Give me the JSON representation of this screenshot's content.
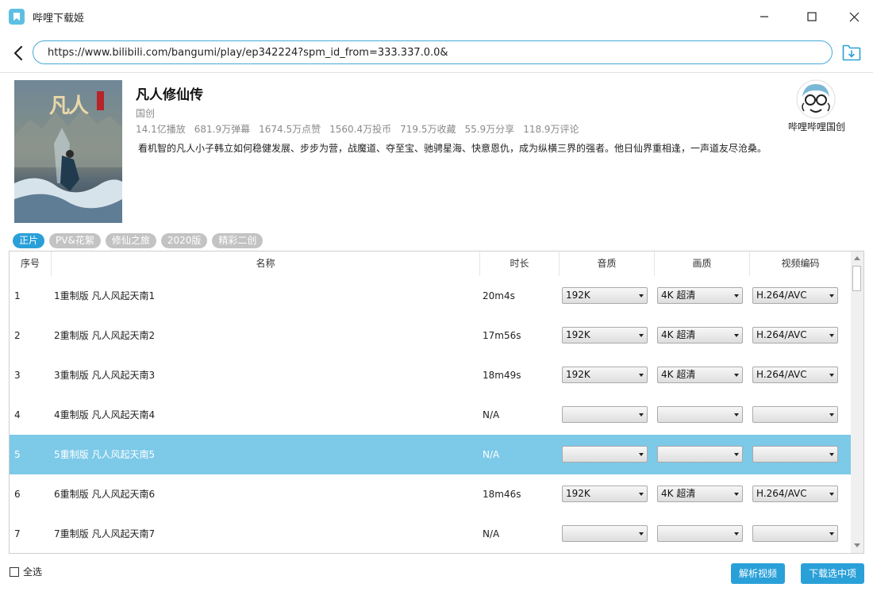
{
  "window": {
    "title": "哔哩下载姬"
  },
  "url_bar": {
    "value": "https://www.bilibili.com/bangumi/play/ep342224?spm_id_from=333.337.0.0&"
  },
  "info": {
    "title": "凡人修仙传",
    "type": "国创",
    "stats": [
      "14.1亿播放",
      "681.9万弹幕",
      "1674.5万点赞",
      "1560.4万投币",
      "719.5万收藏",
      "55.9万分享",
      "118.9万评论"
    ],
    "description": "看机智的凡人小子韩立如何稳健发展、步步为营，战魔道、夺至宝、驰骋星海、快意恩仇，成为纵横三界的强者。他日仙界重相逢，一声道友尽沧桑。",
    "poster_text": "凡人",
    "uploader": "哔哩哔哩国创"
  },
  "tabs": [
    {
      "label": "正片",
      "active": true
    },
    {
      "label": "PV&花絮",
      "active": false
    },
    {
      "label": "修仙之旅",
      "active": false
    },
    {
      "label": "2020版",
      "active": false
    },
    {
      "label": "精彩二创",
      "active": false
    }
  ],
  "table": {
    "columns": [
      "序号",
      "名称",
      "时长",
      "音质",
      "画质",
      "视频编码"
    ],
    "rows": [
      {
        "index": "1",
        "name": "1重制版 凡人风起天南1",
        "duration": "20m4s",
        "audio": "192K",
        "quality": "4K 超清",
        "codec": "H.264/AVC",
        "selected": false
      },
      {
        "index": "2",
        "name": "2重制版 凡人风起天南2",
        "duration": "17m56s",
        "audio": "192K",
        "quality": "4K 超清",
        "codec": "H.264/AVC",
        "selected": false
      },
      {
        "index": "3",
        "name": "3重制版 凡人风起天南3",
        "duration": "18m49s",
        "audio": "192K",
        "quality": "4K 超清",
        "codec": "H.264/AVC",
        "selected": false
      },
      {
        "index": "4",
        "name": "4重制版 凡人风起天南4",
        "duration": "N/A",
        "audio": "",
        "quality": "",
        "codec": "",
        "selected": false
      },
      {
        "index": "5",
        "name": "5重制版 凡人风起天南5",
        "duration": "N/A",
        "audio": "",
        "quality": "",
        "codec": "",
        "selected": true
      },
      {
        "index": "6",
        "name": "6重制版 凡人风起天南6",
        "duration": "18m46s",
        "audio": "192K",
        "quality": "4K 超清",
        "codec": "H.264/AVC",
        "selected": false
      },
      {
        "index": "7",
        "name": "7重制版 凡人风起天南7",
        "duration": "N/A",
        "audio": "",
        "quality": "",
        "codec": "",
        "selected": false
      }
    ]
  },
  "footer": {
    "select_all_label": "全选",
    "parse_button": "解析视频",
    "download_button": "下载选中项"
  },
  "colors": {
    "accent": "#2aa0d8",
    "selected_row": "#7cc9e8",
    "tab_inactive": "#c3c3c3"
  }
}
